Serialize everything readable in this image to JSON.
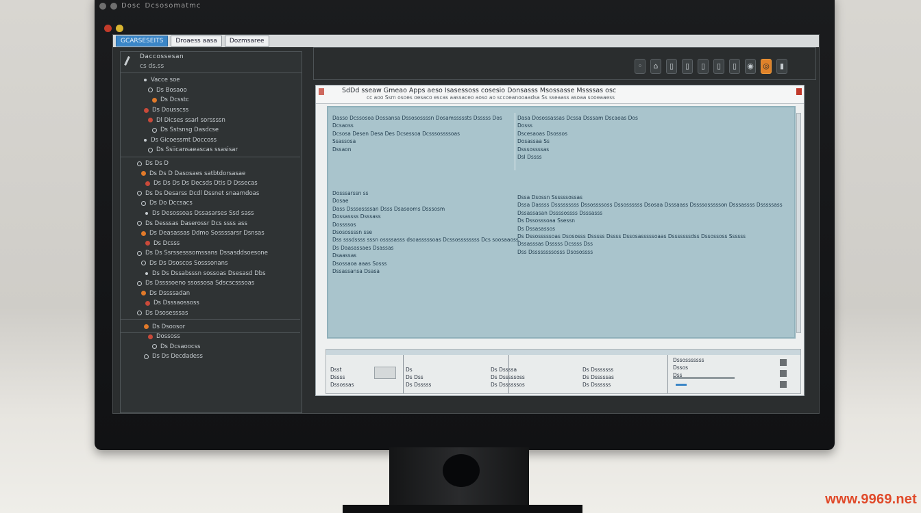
{
  "os_bar": {
    "title": "Dosc",
    "subtitle": "Dcsosomatmc"
  },
  "tabs": [
    {
      "label": "GCARSESEITS"
    },
    {
      "label": "Droaess aasa"
    },
    {
      "label": "Dozmsaree"
    }
  ],
  "sidebar": {
    "title": "Daccossesan",
    "subtitle": "cs ds.ss",
    "sections": [
      {
        "items": [
          "Vacce soe",
          "Ds Bosaoo",
          "Ds Dcsstc",
          "Ds Dousscss",
          "Dl Dicses ssarl sorssssn",
          "Ds Sstsnsg Dasdcse",
          "Ds Gicoessmt Doccoss",
          "Ds Ssiicansaeascas ssasisar"
        ]
      },
      {
        "items": [
          "Ds Ds D",
          "Ds Ds D Dasosaes satbtdorsasae",
          "Ds Ds Ds Ds Decsds Dtis D Dssecas",
          "Ds Ds Desarss Dcdl Dssnet snaamdoas",
          "Ds Do Dccsacs",
          "Ds Desossoas Dssasarses Ssd sass",
          "Ds Desssas Daserossr Dcs ssss ass",
          "Ds Deasassas Ddmo Sossssarsr Dsnsas",
          "Ds Dcsss",
          "Ds Ds Ssrssesssomssans Dssasddsoesone",
          "Ds Ds Dsoscos Sosssonans",
          "Ds Ds Dssabsssn sossoas Dsesasd Dbs",
          "Ds Dssssoeno ssossosa Sdscscsssoas",
          "Ds Dssssadan",
          "Ds Dsssaossoss",
          "Ds Dsosesssas"
        ]
      },
      {
        "items": [
          "Ds Dsoosor",
          "Dossoss",
          "Ds Dcsaoocss",
          "Ds Ds Decdadess"
        ]
      }
    ]
  },
  "toolbar": {
    "buttons": [
      "◦",
      "⌂",
      "▯",
      "▯",
      "▯",
      "▯",
      "▯",
      "◉",
      "◎",
      "▮"
    ]
  },
  "document": {
    "title": "SdDd sseaw Gmeao Apps aeso Isasessoss cosesio Donsasss Msossasse Mssssas osc",
    "subtitle": "cc aoo Ssm osoes oesaco escas aassaceo aoso ao sccoeanooaadsa Ss sseaass asoaa sooeaaess",
    "left_top": [
      "Dasso Dcssosoa Dossansa Dssosossssn Dosamsssssts Dsssss Dos",
      "Dcsaoss",
      "Dcsosa Desen Desa Des Dcsessoa Dcsssossssoas",
      "Ssassosa",
      "Dssaon"
    ],
    "right_top": [
      "Dasa Dosossassas Dcssa Dsssam Dscaoas Dos",
      "Dosss",
      "Dscesaoas Dsossos",
      "Dosassaa Ss",
      "Dsssossssas",
      "Dsl Dssss"
    ],
    "left_bottom": [
      "Dosssarssn ss",
      "Dosae",
      "Dass Dsssossssan Dsss Dsasooms Dsssosm",
      "Dossassss Dsssass",
      "Dossssos",
      "Dsosossssn sse",
      "Dss sssdssss sssn ossssasss dsoasssssoas Dcssossssssss Dcs soosaaoss",
      "Ds Daasassaes Dsassas",
      "Dsaassas",
      "Dsossaoa aaas Sosss",
      "Dssassansa Dsasa"
    ],
    "right_bottom": [
      "Dssa Dsossn Ssssssossas",
      "Dssa Dassss Dsssssssss Dssossssoss Dssossssss Dsosaa Dsssaass Dssssossssson Dsssassss Dsssssass",
      "Dssassasan Dssssossss Dsssasss",
      "Ds Dssosssoaa Ssessn",
      "Ds Dssasassos",
      "Ds Dssosssssoas Dsososss Dsssss Dssss Dssosasssssoaas Dsssssssdss Dssossoss Ssssss",
      "Dssasssas Dsssss Dcssss Dss",
      "Dss Dssssssssosss Dsosossss"
    ]
  },
  "bottom_panel": {
    "col1": [
      "Dsst",
      "Dssss",
      "Dssossas"
    ],
    "col2": [
      "Ds",
      "Ds Dss",
      "Ds Dsssss"
    ],
    "col3": [
      "Ds Dssssa",
      "Ds Dsssssoss",
      "Ds Dssssssos"
    ],
    "col4": [
      "Ds Dsssssss",
      "Ds Dsssssas",
      "Ds Dssssss"
    ],
    "col5": [
      "Dssosssssss",
      "Dssos",
      "Dss"
    ]
  },
  "watermark": "www.9969.net",
  "colors": {
    "accent": "#3b86c7",
    "orange": "#e0822a",
    "pane": "#a9c4cc"
  }
}
